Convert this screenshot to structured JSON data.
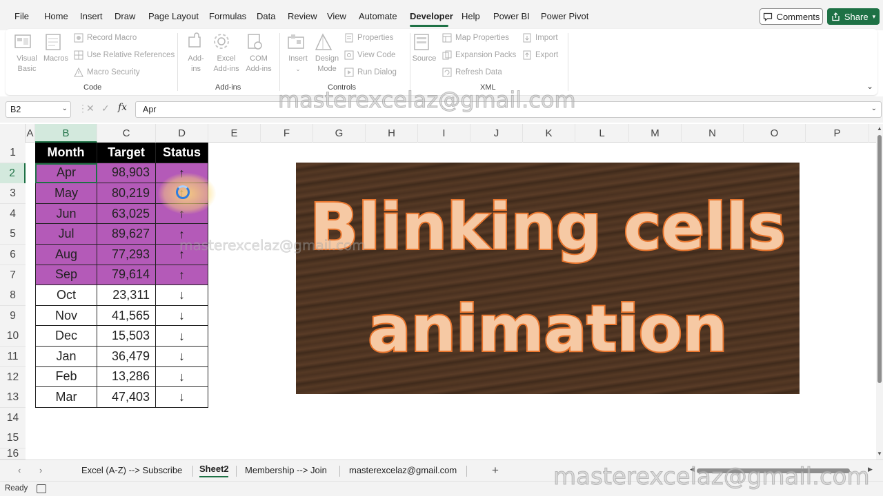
{
  "menubar": {
    "items": [
      "File",
      "Home",
      "Insert",
      "Draw",
      "Page Layout",
      "Formulas",
      "Data",
      "Review",
      "View",
      "Automate",
      "Developer",
      "Help",
      "Power BI",
      "Power Pivot"
    ],
    "active": "Developer",
    "comments_label": "Comments",
    "share_label": "Share",
    "accent_color": "#1e7145"
  },
  "ribbon": {
    "code": {
      "visual_basic": "Visual Basic",
      "macros": "Macros",
      "record_macro": "Record Macro",
      "use_relative_references": "Use Relative References",
      "macro_security": "Macro Security",
      "label": "Code"
    },
    "addins": {
      "addins": "Add-ins",
      "excel_addins": "Excel Add-ins",
      "com_addins": "COM Add-ins",
      "label": "Add-ins"
    },
    "controls": {
      "insert": "Insert",
      "design_mode": "Design Mode",
      "properties": "Properties",
      "view_code": "View Code",
      "run_dialog": "Run Dialog",
      "label": "Controls"
    },
    "xml": {
      "source": "Source",
      "map_properties": "Map Properties",
      "expansion_packs": "Expansion Packs",
      "refresh_data": "Refresh Data",
      "import": "Import",
      "export": "Export",
      "label": "XML"
    }
  },
  "formula_bar": {
    "name_box": "B2",
    "fx": "fx",
    "value": "Apr"
  },
  "columns": [
    "A",
    "B",
    "C",
    "D",
    "E",
    "F",
    "G",
    "H",
    "I",
    "J",
    "K",
    "L",
    "M",
    "N",
    "O",
    "P"
  ],
  "rows": [
    "1",
    "2",
    "3",
    "4",
    "5",
    "6",
    "7",
    "8",
    "9",
    "10",
    "11",
    "12",
    "13",
    "14",
    "15",
    "16"
  ],
  "table": {
    "headers": [
      "Month",
      "Target",
      "Status"
    ],
    "rows": [
      {
        "month": "Apr",
        "target": "98,903",
        "status": "↑",
        "highlight": true
      },
      {
        "month": "May",
        "target": "80,219",
        "status": "↑",
        "highlight": true
      },
      {
        "month": "Jun",
        "target": "63,025",
        "status": "↑",
        "highlight": true
      },
      {
        "month": "Jul",
        "target": "89,627",
        "status": "↑",
        "highlight": true
      },
      {
        "month": "Aug",
        "target": "77,293",
        "status": "↑",
        "highlight": true
      },
      {
        "month": "Sep",
        "target": "79,614",
        "status": "↑",
        "highlight": true
      },
      {
        "month": "Oct",
        "target": "23,311",
        "status": "↓",
        "highlight": false
      },
      {
        "month": "Nov",
        "target": "41,565",
        "status": "↓",
        "highlight": false
      },
      {
        "month": "Dec",
        "target": "15,503",
        "status": "↓",
        "highlight": false
      },
      {
        "month": "Jan",
        "target": "36,479",
        "status": "↓",
        "highlight": false
      },
      {
        "month": "Feb",
        "target": "13,286",
        "status": "↓",
        "highlight": false
      },
      {
        "month": "Mar",
        "target": "47,403",
        "status": "↓",
        "highlight": false
      }
    ],
    "highlight_color": "#b45ab8",
    "header_color": "#000000"
  },
  "banner": {
    "line1": "Blinking cells",
    "line2": "animation"
  },
  "sheet_tabs": {
    "tabs": [
      "Excel (A-Z) --> Subscribe",
      "Sheet2",
      "Membership --> Join",
      "masterexcelaz@gmail.com"
    ],
    "active": "Sheet2",
    "add_label": "+"
  },
  "status_bar": {
    "status": "Ready"
  },
  "watermark": "masterexcelaz@gmail.com"
}
